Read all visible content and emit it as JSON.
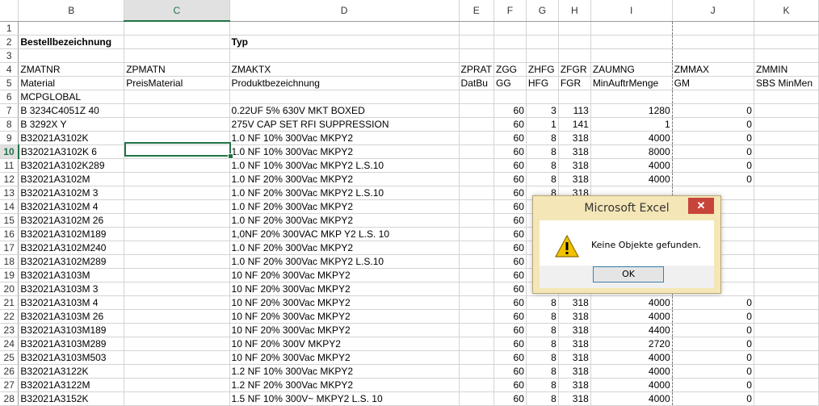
{
  "columns": [
    "B",
    "C",
    "D",
    "E",
    "F",
    "G",
    "H",
    "I",
    "J",
    "K"
  ],
  "selected_column": "C",
  "selected_row": "10",
  "rows": [
    {
      "n": "1",
      "B": "",
      "C": "",
      "D": "",
      "E": "",
      "F": "",
      "G": "",
      "H": "",
      "I": "",
      "J": "",
      "K": ""
    },
    {
      "n": "2",
      "B": "Bestellbezeichnung",
      "C": "",
      "D": "Typ",
      "E": "",
      "F": "",
      "G": "",
      "H": "",
      "I": "",
      "J": "",
      "K": ""
    },
    {
      "n": "3",
      "B": "",
      "C": "",
      "D": "",
      "E": "",
      "F": "",
      "G": "",
      "H": "",
      "I": "",
      "J": "",
      "K": ""
    },
    {
      "n": "4",
      "B": "ZMATNR",
      "C": "ZPMATN",
      "D": "ZMAKTX",
      "E": "ZPRAT",
      "F": "ZGG",
      "G": "ZHFG",
      "H": "ZFGR",
      "I": "ZAUMNG",
      "J": "ZMMAX",
      "K": "ZMMIN"
    },
    {
      "n": "5",
      "B": "Material",
      "C": "PreisMaterial",
      "D": "Produktbezeichnung",
      "E": "DatBu",
      "F": "GG",
      "G": "HFG",
      "H": "FGR",
      "I": "MinAuftrMenge",
      "J": "GM",
      "K": "SBS MinMen"
    },
    {
      "n": "6",
      "B": "MCPGLOBAL",
      "C": "",
      "D": "",
      "E": "",
      "F": "",
      "G": "",
      "H": "",
      "I": "",
      "J": "",
      "K": ""
    },
    {
      "n": "7",
      "B": "B 3234C4051Z 40",
      "C": "",
      "D": " 0.22UF  5%  630V  MKT  BOXED",
      "E": "",
      "F": "60",
      "G": "3",
      "H": "113",
      "I": "1280",
      "J": "0",
      "K": ""
    },
    {
      "n": "8",
      "B": "B 3292X     Y",
      "C": "",
      "D": "275V CAP SET RFI SUPPRESSION",
      "E": "",
      "F": "60",
      "G": "1",
      "H": "141",
      "I": "1",
      "J": "0",
      "K": ""
    },
    {
      "n": "9",
      "B": "B32021A3102K",
      "C": "",
      "D": "1.0 NF   10%   300Vac     MKPY2",
      "E": "",
      "F": "60",
      "G": "8",
      "H": "318",
      "I": "4000",
      "J": "0",
      "K": ""
    },
    {
      "n": "10",
      "B": "B32021A3102K  6",
      "C": "",
      "D": "1.0 NF   10%   300Vac     MKPY2",
      "E": "",
      "F": "60",
      "G": "8",
      "H": "318",
      "I": "8000",
      "J": "0",
      "K": ""
    },
    {
      "n": "11",
      "B": "B32021A3102K289",
      "C": "",
      "D": "1.0 NF   10%   300Vac     MKPY2 L.S.10",
      "E": "",
      "F": "60",
      "G": "8",
      "H": "318",
      "I": "4000",
      "J": "0",
      "K": ""
    },
    {
      "n": "12",
      "B": "B32021A3102M",
      "C": "",
      "D": "1.0 NF   20%   300Vac     MKPY2",
      "E": "",
      "F": "60",
      "G": "8",
      "H": "318",
      "I": "4000",
      "J": "0",
      "K": ""
    },
    {
      "n": "13",
      "B": "B32021A3102M  3",
      "C": "",
      "D": "1.0 NF   20%   300Vac     MKPY2 L.S.10",
      "E": "",
      "F": "60",
      "G": "8",
      "H": "318",
      "I": "",
      "J": "",
      "K": ""
    },
    {
      "n": "14",
      "B": "B32021A3102M  4",
      "C": "",
      "D": "1.0 NF   20%   300Vac     MKPY2",
      "E": "",
      "F": "60",
      "G": "",
      "H": "",
      "I": "",
      "J": "",
      "K": ""
    },
    {
      "n": "15",
      "B": "B32021A3102M 26",
      "C": "",
      "D": "1.0 NF   20%   300Vac     MKPY2",
      "E": "",
      "F": "60",
      "G": "",
      "H": "",
      "I": "",
      "J": "",
      "K": ""
    },
    {
      "n": "16",
      "B": "B32021A3102M189",
      "C": "",
      "D": " 1,0NF   20%   300VAC   MKP Y2 L.S. 10",
      "E": "",
      "F": "60",
      "G": "",
      "H": "",
      "I": "",
      "J": "",
      "K": ""
    },
    {
      "n": "17",
      "B": "B32021A3102M240",
      "C": "",
      "D": "1.0 NF   20%   300Vac     MKPY2",
      "E": "",
      "F": "60",
      "G": "",
      "H": "",
      "I": "",
      "J": "",
      "K": ""
    },
    {
      "n": "18",
      "B": "B32021A3102M289",
      "C": "",
      "D": "1.0 NF   20%   300Vac     MKPY2 L.S.10",
      "E": "",
      "F": "60",
      "G": "",
      "H": "",
      "I": "",
      "J": "",
      "K": ""
    },
    {
      "n": "19",
      "B": "B32021A3103M",
      "C": "",
      "D": "10 NF   20%   300Vac     MKPY2",
      "E": "",
      "F": "60",
      "G": "",
      "H": "",
      "I": "",
      "J": "",
      "K": ""
    },
    {
      "n": "20",
      "B": "B32021A3103M  3",
      "C": "",
      "D": "10 NF   20%   300Vac     MKPY2",
      "E": "",
      "F": "60",
      "G": "",
      "H": "",
      "I": "",
      "J": "",
      "K": ""
    },
    {
      "n": "21",
      "B": "B32021A3103M  4",
      "C": "",
      "D": "10 NF   20%   300Vac     MKPY2",
      "E": "",
      "F": "60",
      "G": "8",
      "H": "318",
      "I": "4000",
      "J": "0",
      "K": ""
    },
    {
      "n": "22",
      "B": "B32021A3103M 26",
      "C": "",
      "D": "10 NF   20%   300Vac     MKPY2",
      "E": "",
      "F": "60",
      "G": "8",
      "H": "318",
      "I": "4000",
      "J": "0",
      "K": ""
    },
    {
      "n": "23",
      "B": "B32021A3103M189",
      "C": "",
      "D": "10 NF   20%   300Vac     MKPY2",
      "E": "",
      "F": "60",
      "G": "8",
      "H": "318",
      "I": "4400",
      "J": "0",
      "K": ""
    },
    {
      "n": "24",
      "B": "B32021A3103M289",
      "C": "",
      "D": "10 NF   20%   300V     MKPY2",
      "E": "",
      "F": "60",
      "G": "8",
      "H": "318",
      "I": "2720",
      "J": "0",
      "K": ""
    },
    {
      "n": "25",
      "B": "B32021A3103M503",
      "C": "",
      "D": "10 NF   20%   300Vac     MKPY2",
      "E": "",
      "F": "60",
      "G": "8",
      "H": "318",
      "I": "4000",
      "J": "0",
      "K": ""
    },
    {
      "n": "26",
      "B": "B32021A3122K",
      "C": "",
      "D": "1.2 NF   10%   300Vac     MKPY2",
      "E": "",
      "F": "60",
      "G": "8",
      "H": "318",
      "I": "4000",
      "J": "0",
      "K": ""
    },
    {
      "n": "27",
      "B": "B32021A3122M",
      "C": "",
      "D": "1.2 NF   20%   300Vac     MKPY2",
      "E": "",
      "F": "60",
      "G": "8",
      "H": "318",
      "I": "4000",
      "J": "0",
      "K": ""
    },
    {
      "n": "28",
      "B": "B32021A3152K",
      "C": "",
      "D": "1.5 NF 10%  300V~  MKPY2 L.S. 10",
      "E": "",
      "F": "60",
      "G": "8",
      "H": "318",
      "I": "4000",
      "J": "0",
      "K": ""
    }
  ],
  "dialog": {
    "title": "Microsoft Excel",
    "close_glyph": "✕",
    "message": "Keine Objekte gefunden.",
    "ok_label": "OK",
    "icon": "warning-icon"
  },
  "colors": {
    "accent": "#217346",
    "dialog_frame": "#f4e6b6",
    "close_button": "#c7443a",
    "warning": "#f2c200"
  }
}
